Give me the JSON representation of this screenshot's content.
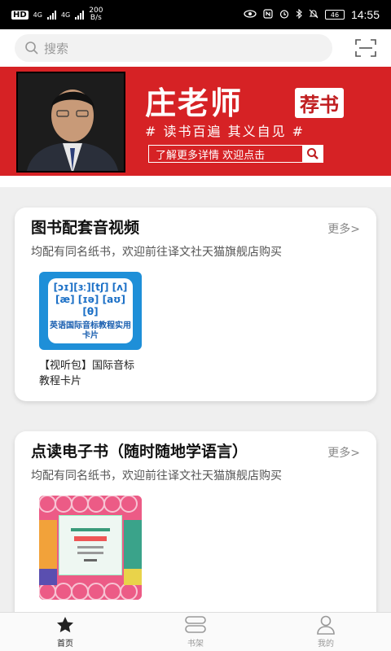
{
  "status": {
    "left_badges": [
      "HD",
      "4G",
      "4G"
    ],
    "net_speed_value": "200",
    "net_speed_unit": "B/s",
    "battery": "46",
    "time": "14:55"
  },
  "search": {
    "placeholder": "搜索"
  },
  "banner": {
    "title": "庄老师",
    "tag": "荐书",
    "slogan": "# 读书百遍 其义自见 #",
    "link": "了解更多详情 欢迎点击"
  },
  "sections": [
    {
      "title": "图书配套音视频",
      "more": "更多>",
      "desc": "均配有同名纸书，欢迎前往译文社天猫旗舰店购买",
      "items": [
        {
          "name": "【视听包】国际音标教程卡片",
          "cover_ipa": "[ɔɪ][ɜː][tʃ] [ʌ] [æ] [ɪə] [aʊ] [θ]",
          "cover_label": "英语国际音标教程实用卡片"
        }
      ]
    },
    {
      "title": "点读电子书（随时随地学语言）",
      "more": "更多>",
      "desc": "均配有同名纸书，欢迎前往译文社天猫旗舰店购买",
      "items": [
        {
          "name": ""
        }
      ]
    }
  ],
  "tabs": [
    {
      "label": "首页",
      "icon": "star-icon",
      "active": true
    },
    {
      "label": "书架",
      "icon": "bookshelf-icon",
      "active": false
    },
    {
      "label": "我的",
      "icon": "user-icon",
      "active": false
    }
  ],
  "colors": {
    "brand_red": "#d62225",
    "tab_active": "#222222",
    "tab_inactive": "#999999"
  }
}
